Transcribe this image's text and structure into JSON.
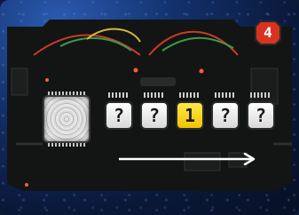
{
  "level": "4",
  "slots": [
    {
      "value": "?"
    },
    {
      "value": "?"
    },
    {
      "value": "1"
    },
    {
      "value": "?"
    },
    {
      "value": "?"
    }
  ],
  "selected_slot": 3,
  "colors": {
    "background": "#0c1a36",
    "board": "#121514",
    "badge": "#d9331f",
    "selected": "#f1c400",
    "tile": "#ffffff"
  }
}
